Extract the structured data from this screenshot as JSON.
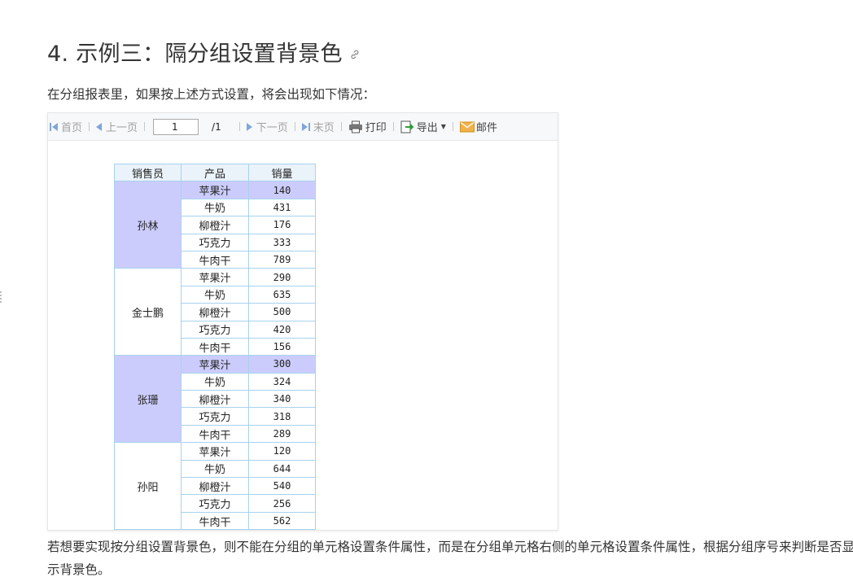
{
  "heading": {
    "title": "4. 示例三：隔分组设置背景色"
  },
  "intro": "在分组报表里，如果按上述方式设置，将会出现如下情况：",
  "toolbar": {
    "first": "首页",
    "prev": "上一页",
    "page_value": "1",
    "page_total": "/1",
    "next": "下一页",
    "last": "末页",
    "print": "打印",
    "export": "导出",
    "mail": "邮件"
  },
  "colors": {
    "highlight": "#ccccfc",
    "grid_border": "#a7d2ee",
    "nav_icon": "#7fa7d8"
  },
  "table": {
    "headers": [
      "销售员",
      "产品",
      "销量"
    ],
    "groups": [
      {
        "seller": "孙林",
        "highlight": true,
        "rows": [
          {
            "product": "苹果汁",
            "qty": "140",
            "highlight": true
          },
          {
            "product": "牛奶",
            "qty": "431",
            "highlight": false
          },
          {
            "product": "柳橙汁",
            "qty": "176",
            "highlight": false
          },
          {
            "product": "巧克力",
            "qty": "333",
            "highlight": false
          },
          {
            "product": "牛肉干",
            "qty": "789",
            "highlight": false
          }
        ]
      },
      {
        "seller": "金士鹏",
        "highlight": false,
        "rows": [
          {
            "product": "苹果汁",
            "qty": "290",
            "highlight": false
          },
          {
            "product": "牛奶",
            "qty": "635",
            "highlight": false
          },
          {
            "product": "柳橙汁",
            "qty": "500",
            "highlight": false
          },
          {
            "product": "巧克力",
            "qty": "420",
            "highlight": false
          },
          {
            "product": "牛肉干",
            "qty": "156",
            "highlight": false
          }
        ]
      },
      {
        "seller": "张珊",
        "highlight": true,
        "rows": [
          {
            "product": "苹果汁",
            "qty": "300",
            "highlight": true
          },
          {
            "product": "牛奶",
            "qty": "324",
            "highlight": false
          },
          {
            "product": "柳橙汁",
            "qty": "340",
            "highlight": false
          },
          {
            "product": "巧克力",
            "qty": "318",
            "highlight": false
          },
          {
            "product": "牛肉干",
            "qty": "289",
            "highlight": false
          }
        ]
      },
      {
        "seller": "孙阳",
        "highlight": false,
        "rows": [
          {
            "product": "苹果汁",
            "qty": "120",
            "highlight": false
          },
          {
            "product": "牛奶",
            "qty": "644",
            "highlight": false
          },
          {
            "product": "柳橙汁",
            "qty": "540",
            "highlight": false
          },
          {
            "product": "巧克力",
            "qty": "256",
            "highlight": false
          },
          {
            "product": "牛肉干",
            "qty": "562",
            "highlight": false
          }
        ]
      }
    ]
  },
  "note": "若想要实现按分组设置背景色，则不能在分组的单元格设置条件属性，而是在分组单元格右侧的单元格设置条件属性，根据分组序号来判断是否显示背景色。"
}
